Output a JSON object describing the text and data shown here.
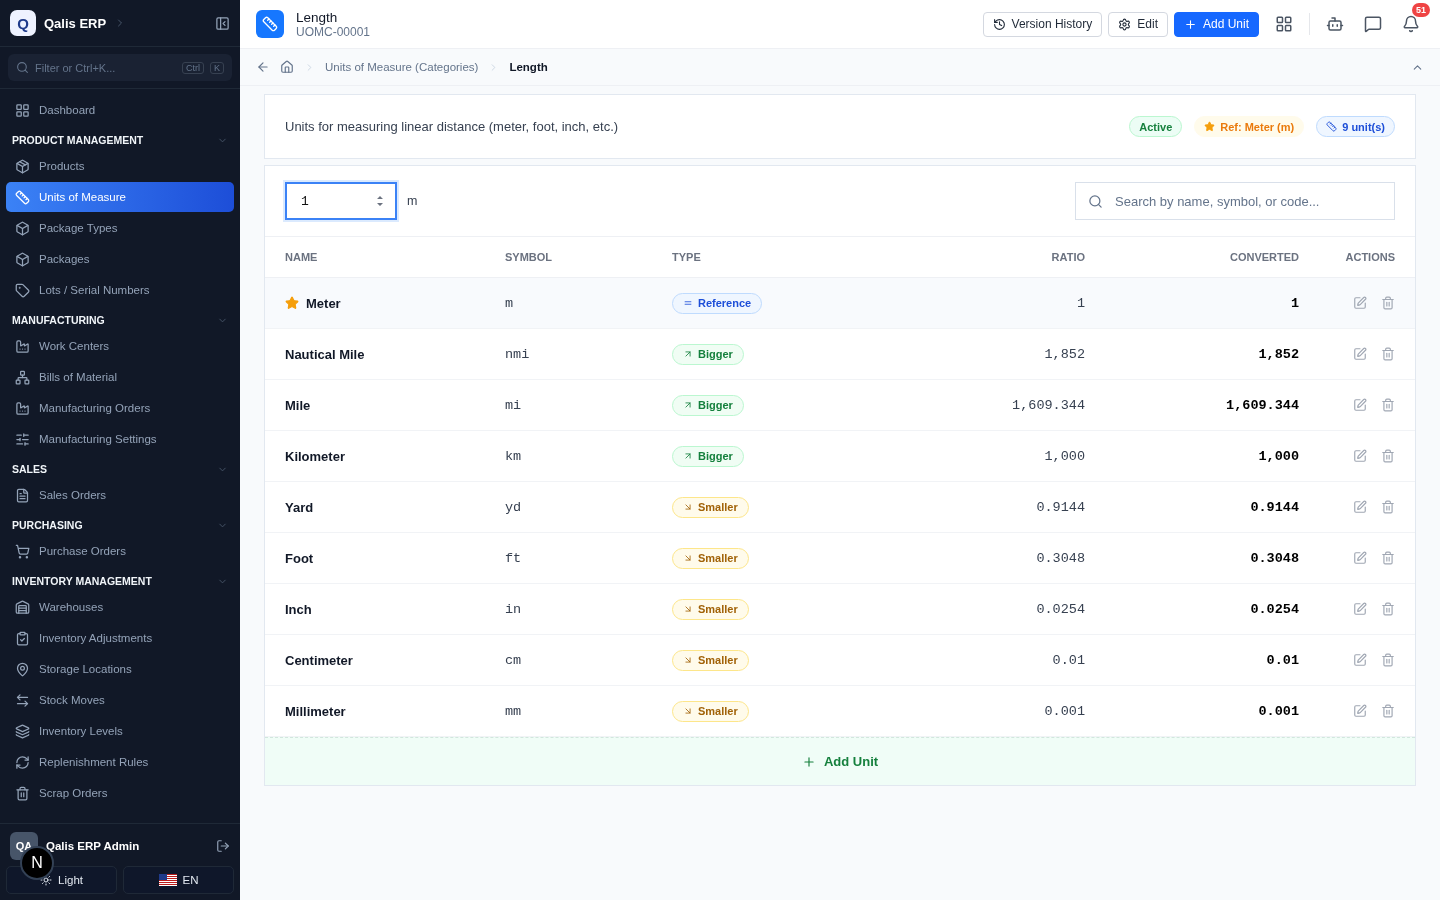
{
  "sidebar": {
    "brand": "Qalis ERP",
    "brand_logo": "Q",
    "filter": {
      "placeholder": "Filter or Ctrl+K...",
      "keys": [
        "Ctrl",
        "K"
      ]
    },
    "top_items": [
      {
        "label": "Dashboard",
        "selected": false
      }
    ],
    "sections": [
      {
        "title": "PRODUCT MANAGEMENT",
        "expanded": true,
        "items": [
          {
            "label": "Products",
            "selected": false
          },
          {
            "label": "Units of Measure",
            "selected": true
          },
          {
            "label": "Package Types",
            "selected": false
          },
          {
            "label": "Packages",
            "selected": false
          },
          {
            "label": "Lots / Serial Numbers",
            "selected": false
          }
        ]
      },
      {
        "title": "MANUFACTURING",
        "expanded": true,
        "items": [
          {
            "label": "Work Centers",
            "selected": false
          },
          {
            "label": "Bills of Material",
            "selected": false
          },
          {
            "label": "Manufacturing Orders",
            "selected": false
          },
          {
            "label": "Manufacturing Settings",
            "selected": false
          }
        ]
      },
      {
        "title": "SALES",
        "expanded": true,
        "items": [
          {
            "label": "Sales Orders",
            "selected": false
          }
        ]
      },
      {
        "title": "PURCHASING",
        "expanded": true,
        "items": [
          {
            "label": "Purchase Orders",
            "selected": false
          }
        ]
      },
      {
        "title": "INVENTORY MANAGEMENT",
        "expanded": true,
        "items": [
          {
            "label": "Warehouses",
            "selected": false
          },
          {
            "label": "Inventory Adjustments",
            "selected": false
          },
          {
            "label": "Storage Locations",
            "selected": false
          },
          {
            "label": "Stock Moves",
            "selected": false
          },
          {
            "label": "Inventory Levels",
            "selected": false
          },
          {
            "label": "Replenishment Rules",
            "selected": false
          },
          {
            "label": "Scrap Orders",
            "selected": false
          }
        ]
      }
    ],
    "user": {
      "initials": "QA",
      "name": "Qalis ERP Admin"
    },
    "theme_button": "Light",
    "language_button": "EN",
    "dev_badge": "N"
  },
  "header": {
    "title": "Length",
    "code": "UOMC-00001",
    "buttons": [
      {
        "label": "Version History",
        "kind": "history"
      },
      {
        "label": "Edit",
        "kind": "edit"
      },
      {
        "label": "Add Unit",
        "kind": "primary"
      }
    ],
    "notification_count": "51"
  },
  "breadcrumb": [
    "Units of Measure (Categories)",
    "Length"
  ],
  "summary": {
    "description": "Units for measuring linear distance (meter, foot, inch, etc.)",
    "badges": [
      {
        "label": "Active",
        "kind": "status"
      },
      {
        "label": "Ref: Meter (m)",
        "kind": "reference"
      },
      {
        "label": "9 unit(s)",
        "kind": "count"
      }
    ]
  },
  "converter": {
    "value": "1",
    "unit": "m"
  },
  "search": {
    "placeholder": "Search by name, symbol, or code..."
  },
  "table": {
    "columns": [
      "NAME",
      "SYMBOL",
      "TYPE",
      "RATIO",
      "CONVERTED",
      "ACTIONS"
    ],
    "rows": [
      {
        "name": "Meter",
        "starred": true,
        "symbol": "m",
        "type": {
          "kind": "reference",
          "label": "Reference"
        },
        "ratio": "1",
        "converted": "1"
      },
      {
        "name": "Nautical Mile",
        "starred": false,
        "symbol": "nmi",
        "type": {
          "kind": "bigger",
          "label": "Bigger"
        },
        "ratio": "1,852",
        "converted": "1,852"
      },
      {
        "name": "Mile",
        "starred": false,
        "symbol": "mi",
        "type": {
          "kind": "bigger",
          "label": "Bigger"
        },
        "ratio": "1,609.344",
        "converted": "1,609.344"
      },
      {
        "name": "Kilometer",
        "starred": false,
        "symbol": "km",
        "type": {
          "kind": "bigger",
          "label": "Bigger"
        },
        "ratio": "1,000",
        "converted": "1,000"
      },
      {
        "name": "Yard",
        "starred": false,
        "symbol": "yd",
        "type": {
          "kind": "smaller",
          "label": "Smaller"
        },
        "ratio": "0.9144",
        "converted": "0.9144"
      },
      {
        "name": "Foot",
        "starred": false,
        "symbol": "ft",
        "type": {
          "kind": "smaller",
          "label": "Smaller"
        },
        "ratio": "0.3048",
        "converted": "0.3048"
      },
      {
        "name": "Inch",
        "starred": false,
        "symbol": "in",
        "type": {
          "kind": "smaller",
          "label": "Smaller"
        },
        "ratio": "0.0254",
        "converted": "0.0254"
      },
      {
        "name": "Centimeter",
        "starred": false,
        "symbol": "cm",
        "type": {
          "kind": "smaller",
          "label": "Smaller"
        },
        "ratio": "0.01",
        "converted": "0.01"
      },
      {
        "name": "Millimeter",
        "starred": false,
        "symbol": "mm",
        "type": {
          "kind": "smaller",
          "label": "Smaller"
        },
        "ratio": "0.001",
        "converted": "0.001"
      }
    ],
    "add_button": "Add Unit"
  }
}
